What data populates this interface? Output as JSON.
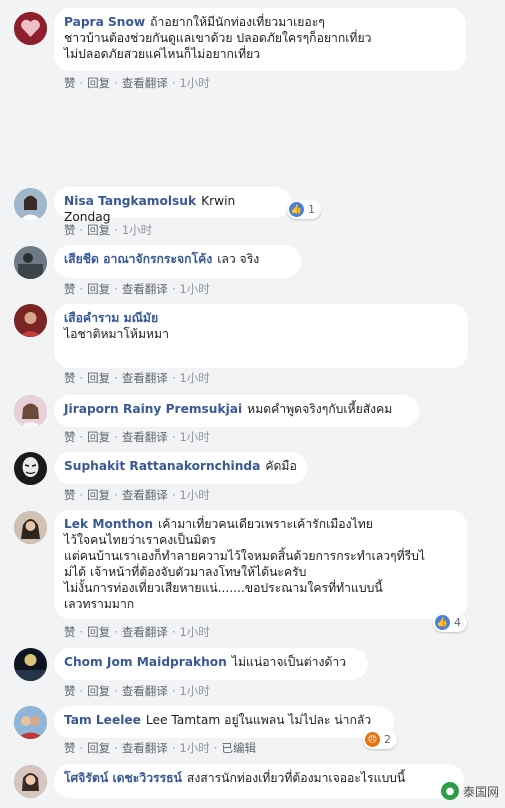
{
  "actions": {
    "like": "赞",
    "reply": "回复",
    "translate": "查看翻译",
    "time": "1小时",
    "edited": "已编辑",
    "sep": "·"
  },
  "comments": [
    {
      "name": "Papra Snow",
      "text": "ถ้าอยากให้มีนักท่องเที่ยวมาเยอะๆ\nชาวบ้านต้องช่วยกันดูแลเขาด้วย ปลอดภัยใครๆก็อยากเที่ยว\nไม่ปลอดภัยสวยแค่ไหนก็ไม่อยากเที่ยว"
    },
    {
      "name": "Nisa Tangkamolsuk",
      "text": "Krwin Zondag",
      "reaction_count": "1"
    },
    {
      "name": "เสียชีด อาณาจักรกระจกโค้ง",
      "text": "เลว จริง"
    },
    {
      "name": "เสือคำราม มณีมัย",
      "text": "ไอชาติหมาโห้มหมา"
    },
    {
      "name": "Jiraporn Rainy Premsukjai",
      "text": "หมดคำพูดจริงๆกับเหี้ยสังคม"
    },
    {
      "name": "Suphakit Rattanakornchinda",
      "text": "คัดมือ"
    },
    {
      "name": "Lek Monthon",
      "text": "เค้ามาเที่ยวคนเดียวเพราะเค้ารักเมืองไทย\nไว้ใจคนไทยว่าเราคงเป็นมิตร\nแต่คนบ้านเราเองก็ทำลายความไว้ใจหมดสิ้นด้วยการกระทำเลวๆที่รีบไ\nม่ได้ เจ้าหน้าที่ต้องจับตัวมาลงโทษให้ได้นะครับ\nไม่งั้นการท่องเที่ยวเสียหายแน่.......ขอประณามใครที่ทำแบบนี้\nเลวทรามมาก",
      "reaction_count": "4"
    },
    {
      "name": "Chom Jom Maidprakhon",
      "text": "ไม่แน่อาจเป็นต่างด้าว"
    },
    {
      "name": "Tam Leelee",
      "text": "Lee Tamtam อยู่ในแพลน ไม่ไปละ น่ากลัว",
      "reaction_count": "2"
    },
    {
      "name": "โศจิรัตน์ เดชะวิวรรธน์",
      "text": "สงสารนักท่องเที่ยวที่ต้องมาเจออะไรแบบนี้"
    }
  ],
  "watermark": "泰国网",
  "colors": {
    "name": "#385898",
    "background": "#f2f3f5",
    "like": "#4a7fe0",
    "angry": "#e9710f"
  }
}
